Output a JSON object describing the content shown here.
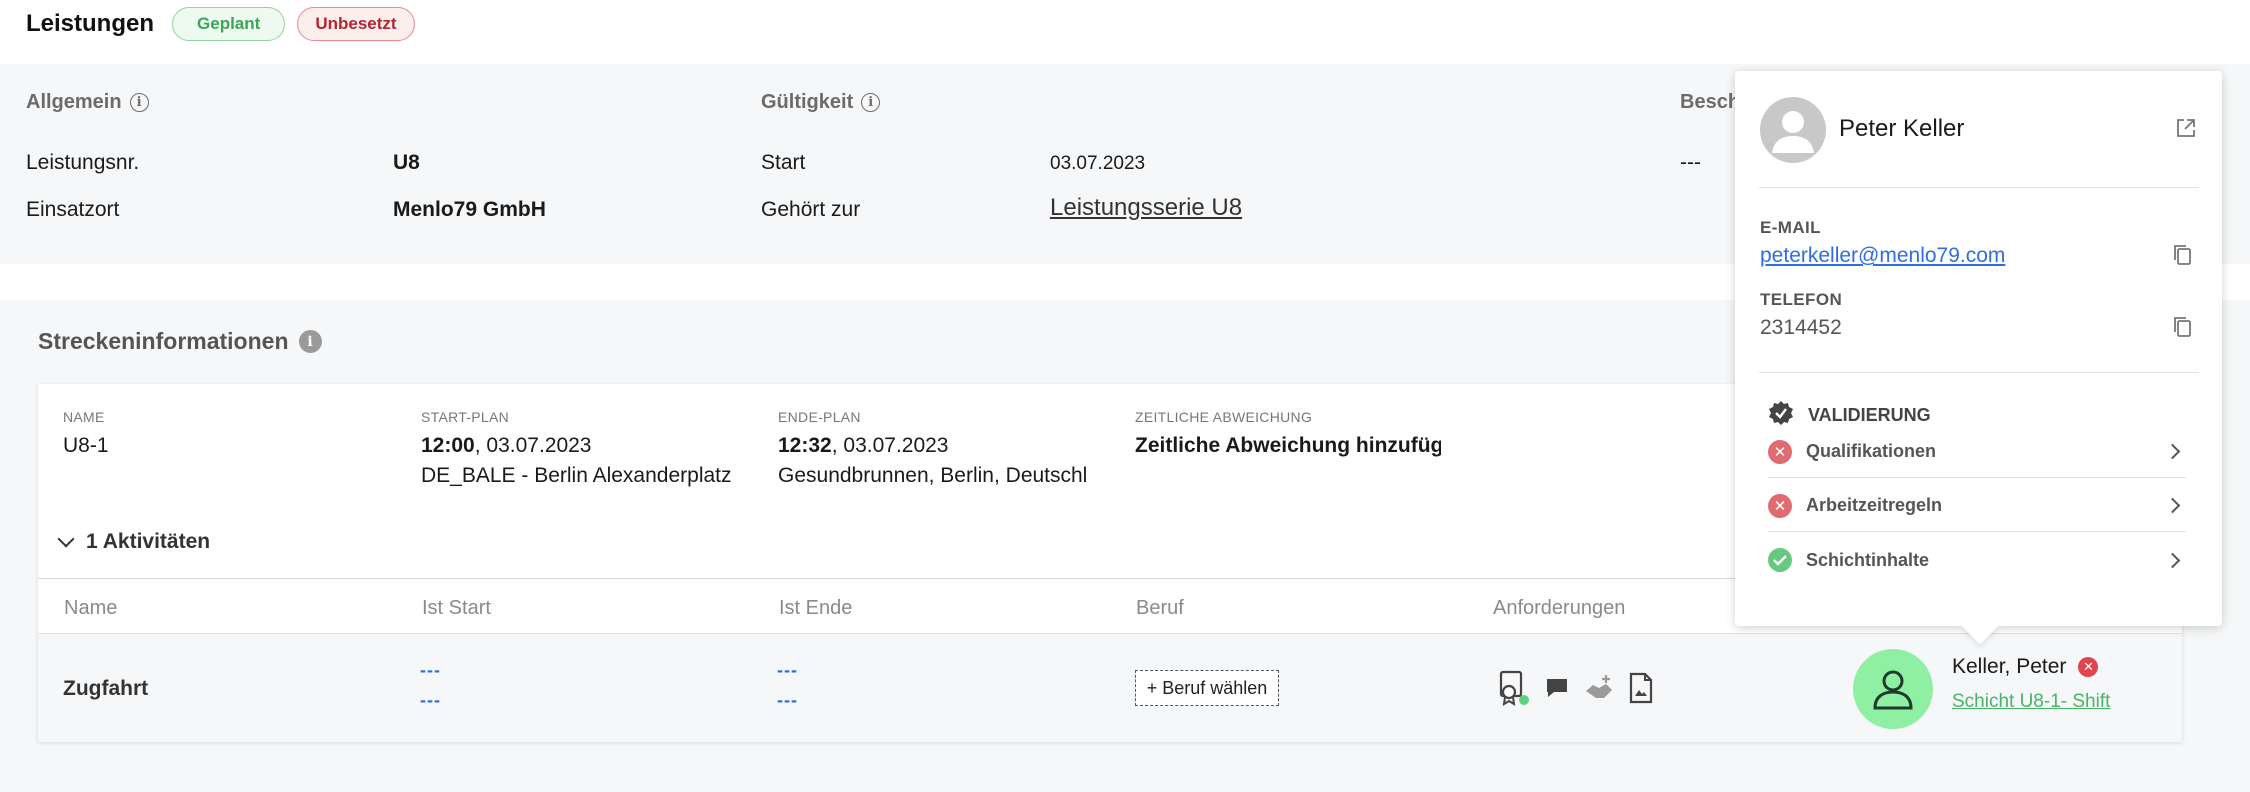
{
  "header": {
    "title": "Leistungen",
    "badge_planned": "Geplant",
    "badge_unassigned": "Unbesetzt"
  },
  "general": {
    "allgemein_title": "Allgemein",
    "gueltigkeit_title": "Gültigkeit",
    "beschreibung_title_partial": "Besch",
    "leistungsnr_label": "Leistungsnr.",
    "leistungsnr_value": "U8",
    "einsatzort_label": "Einsatzort",
    "einsatzort_value": "Menlo79 GmbH",
    "start_label": "Start",
    "start_value": "03.07.2023",
    "gehoert_label": "Gehört zur",
    "gehoert_value": "Leistungsserie U8",
    "beschreibung_value": "---"
  },
  "route": {
    "title": "Streckeninformationen",
    "name_label": "NAME",
    "name_value": "U8-1",
    "start_label": "START-PLAN",
    "start_time": "12:00",
    "start_date": ", 03.07.2023",
    "start_location": "DE_BALE - Berlin Alexanderplatz",
    "end_label": "ENDE-PLAN",
    "end_time": "12:32",
    "end_date": ", 03.07.2023",
    "end_location": "Gesundbrunnen, Berlin, Deutschl",
    "deviation_label": "ZEITLICHE ABWEICHUNG",
    "deviation_value": "Zeitliche Abweichung hinzufüge",
    "activities_toggle": "1 Aktivitäten",
    "columns": [
      "Name",
      "Ist Start",
      "Ist Ende",
      "Beruf",
      "Anforderungen"
    ],
    "row": {
      "name": "Zugfahrt",
      "ist_start_1": "---",
      "ist_start_2": "---",
      "ist_ende_1": "---",
      "ist_ende_2": "---",
      "beruf_button": "+ Beruf wählen",
      "person_name": "Keller, Peter",
      "shift_link": "Schicht U8-1- Shift"
    }
  },
  "popup": {
    "name": "Peter Keller",
    "email_label": "E-MAIL",
    "email_value": "peterkeller@menlo79.com",
    "phone_label": "TELEFON",
    "phone_value": "2314452",
    "validation_title": "VALIDIERUNG",
    "validation_items": [
      {
        "label": "Qualifikationen",
        "status": "error"
      },
      {
        "label": "Arbeitzeitregeln",
        "status": "error"
      },
      {
        "label": "Schichtinhalte",
        "status": "ok"
      }
    ]
  },
  "colors": {
    "accent_blue": "#2f6ee0",
    "success_green": "#46b566",
    "error_red": "#e0454f",
    "avatar_green": "#8ff0a4"
  }
}
